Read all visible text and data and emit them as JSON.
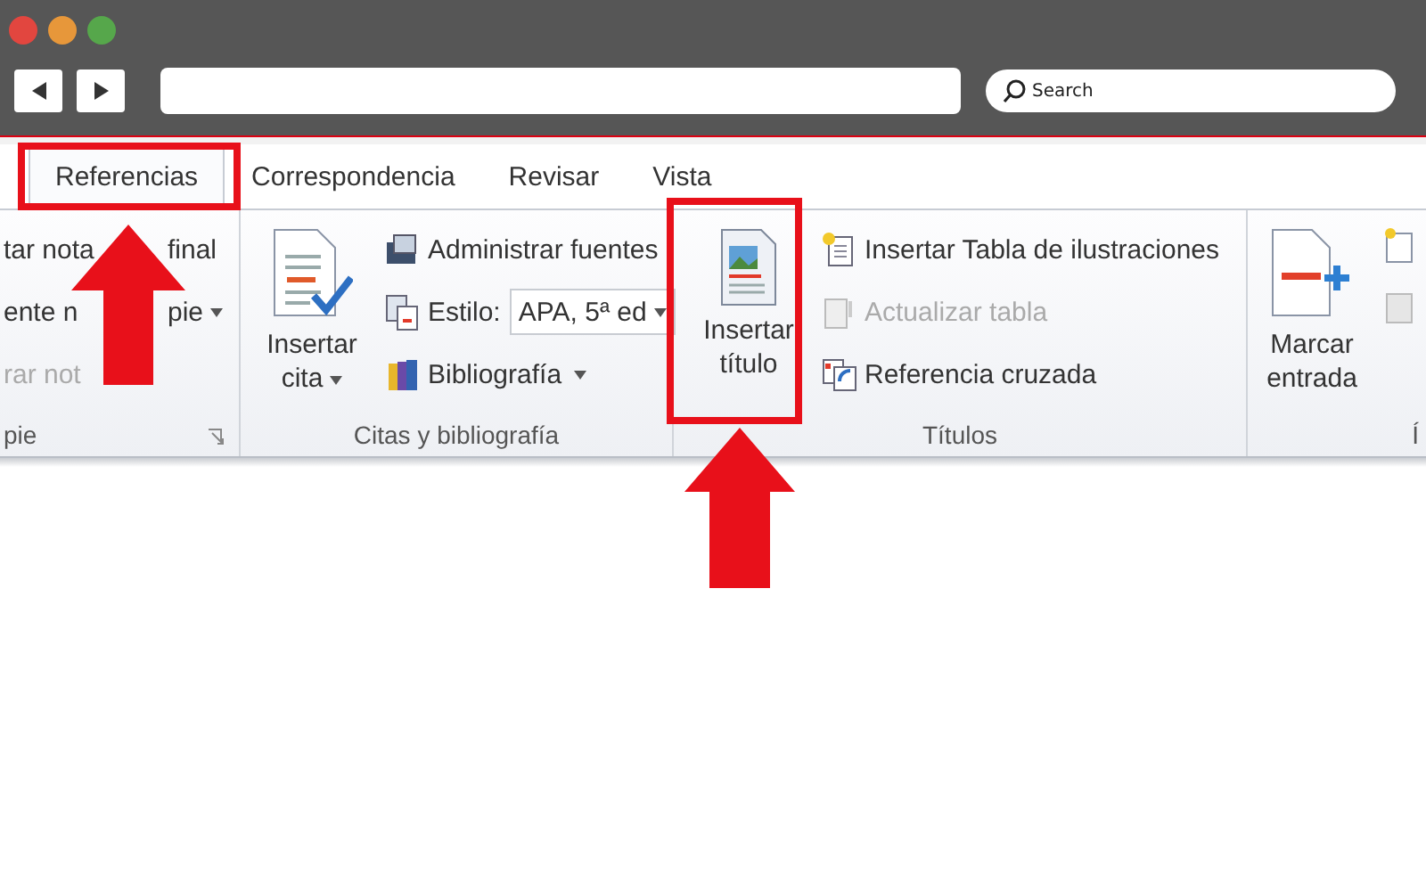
{
  "browser": {
    "search": {
      "placeholder": "Search"
    }
  },
  "tabs": [
    {
      "label": "Referencias",
      "selected": true
    },
    {
      "label": "Correspondencia",
      "selected": false
    },
    {
      "label": "Revisar",
      "selected": false
    },
    {
      "label": "Vista",
      "selected": false
    }
  ],
  "groups": [
    {
      "label": "pie",
      "launcher": true,
      "items": [
        {
          "kind": "small",
          "parts": [
            "tar nota",
            "final"
          ],
          "disabled": false
        },
        {
          "kind": "small",
          "parts": [
            "ente n",
            "pie"
          ],
          "disabled": false,
          "caret": true
        },
        {
          "kind": "small",
          "parts": [
            "rar not"
          ],
          "disabled": true
        }
      ]
    },
    {
      "label": "Citas y bibliografía",
      "items": [
        {
          "kind": "big",
          "label": "Insertar cita",
          "caret": true
        },
        {
          "kind": "small",
          "parts": [
            "Administrar fuentes"
          ],
          "disabled": false
        },
        {
          "kind": "style",
          "label": "Estilo:",
          "value": "APA, 5ª ed"
        },
        {
          "kind": "small",
          "parts": [
            "Bibliografía"
          ],
          "disabled": false,
          "caret": true
        }
      ]
    },
    {
      "label": "Títulos",
      "items": [
        {
          "kind": "big",
          "label": "Insertar título"
        },
        {
          "kind": "small",
          "parts": [
            "Insertar Tabla de ilustraciones"
          ],
          "disabled": false
        },
        {
          "kind": "small",
          "parts": [
            "Actualizar tabla"
          ],
          "disabled": true
        },
        {
          "kind": "small",
          "parts": [
            "Referencia cruzada"
          ],
          "disabled": false
        }
      ]
    },
    {
      "label": "Í",
      "items": [
        {
          "kind": "big",
          "label": "Marcar entrada"
        },
        {
          "kind": "stub"
        }
      ]
    }
  ]
}
